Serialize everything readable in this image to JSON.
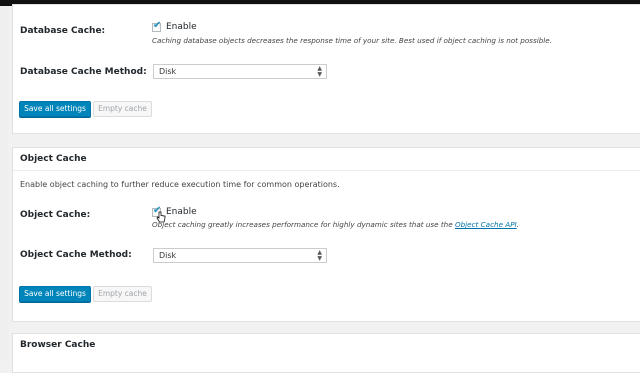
{
  "database_cache": {
    "label": "Database Cache:",
    "enable_label": "Enable",
    "enabled": true,
    "description": "Caching database objects decreases the response time of your site. Best used if object caching is not possible.",
    "method_label": "Database Cache Method:",
    "method_value": "Disk",
    "save_button": "Save all settings",
    "empty_button": "Empty cache"
  },
  "object_cache": {
    "title": "Object Cache",
    "intro": "Enable object caching to further reduce execution time for common operations.",
    "label": "Object Cache:",
    "enable_label": "Enable",
    "enabled": true,
    "description_prefix": "Object caching greatly increases performance for highly dynamic sites that use the ",
    "description_link": "Object Cache API",
    "description_suffix": ".",
    "method_label": "Object Cache Method:",
    "method_value": "Disk",
    "save_button": "Save all settings",
    "empty_button": "Empty cache"
  },
  "browser_cache": {
    "title": "Browser Cache"
  },
  "colors": {
    "primary_button": "#0085ba",
    "link": "#0073aa",
    "checkmark": "#1e8cbe",
    "panel_bg": "#ffffff",
    "page_bg": "#f1f1f1"
  }
}
